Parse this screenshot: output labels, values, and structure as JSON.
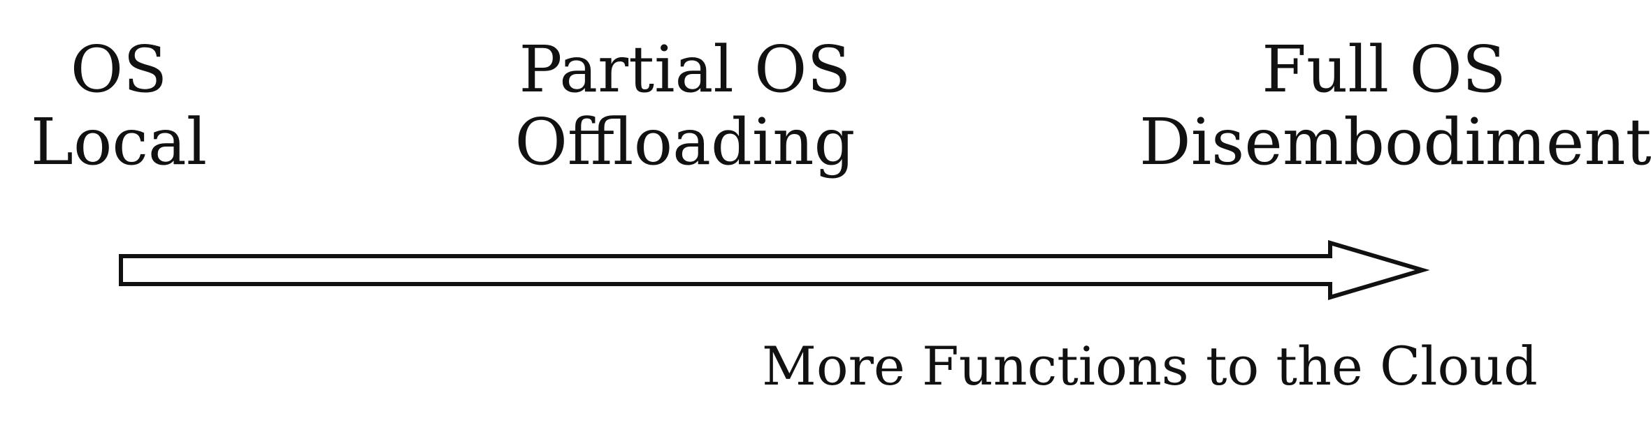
{
  "stages": [
    {
      "line1": "OS",
      "line2": "Local"
    },
    {
      "line1": "Partial OS",
      "line2": "Offloading"
    },
    {
      "line1": "Full OS",
      "line2": "Disembodiment"
    }
  ],
  "arrow": {
    "caption": "More Functions to the Cloud",
    "stroke_color": "#111111",
    "fill_color": "#ffffff"
  }
}
